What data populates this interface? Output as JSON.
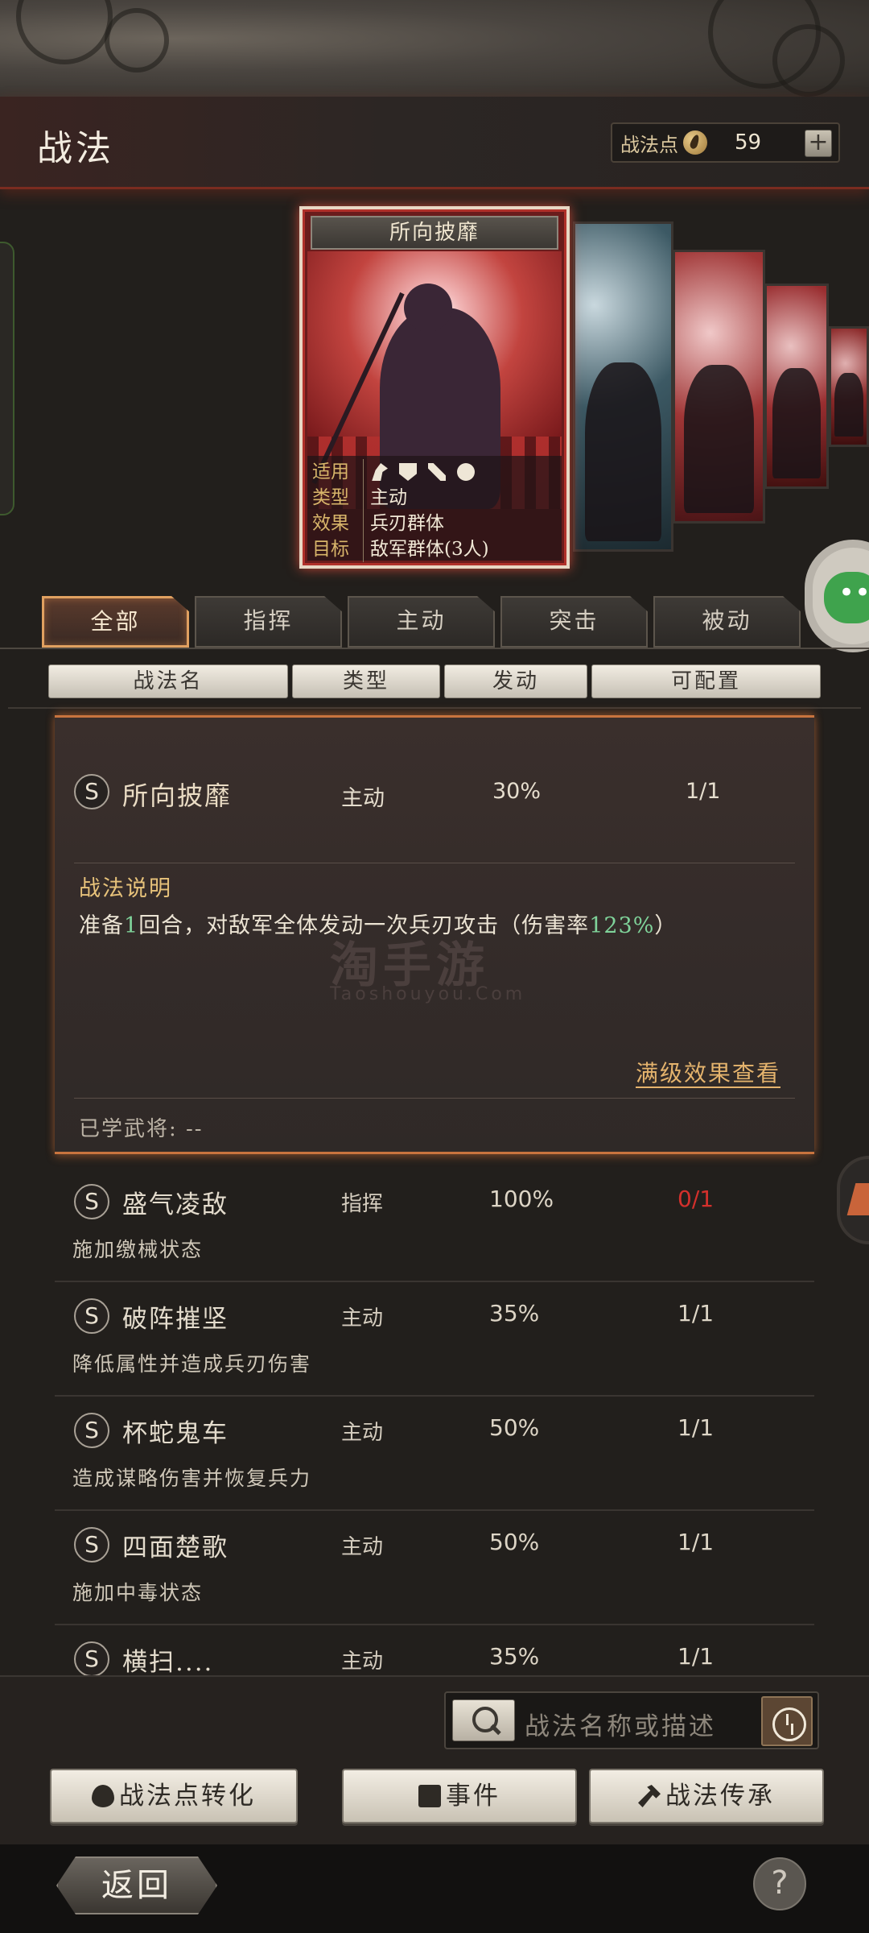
{
  "header": {
    "title": "战法",
    "points_label": "战法点",
    "points_value": "59",
    "add_label": "+"
  },
  "card": {
    "name": "所向披靡",
    "rows": [
      {
        "key": "适用",
        "value": ""
      },
      {
        "key": "类型",
        "value": "主动"
      },
      {
        "key": "效果",
        "value": "兵刃群体"
      },
      {
        "key": "目标",
        "value": "敌军群体(3人)"
      }
    ],
    "apply_icons": [
      "horse-icon",
      "shield-icon",
      "bow-icon",
      "wheel-icon"
    ]
  },
  "tabs": [
    {
      "label": "全部",
      "active": true
    },
    {
      "label": "指挥",
      "active": false
    },
    {
      "label": "主动",
      "active": false
    },
    {
      "label": "突击",
      "active": false
    },
    {
      "label": "被动",
      "active": false
    }
  ],
  "table_headers": [
    "战法名",
    "类型",
    "发动",
    "可配置"
  ],
  "expanded": {
    "grade": "S",
    "name": "所向披靡",
    "type": "主动",
    "rate": "30%",
    "config": "1/1",
    "desc_title": "战法说明",
    "desc_a": "准备",
    "desc_b": "1",
    "desc_c": "回合，对敌军全体发动一次兵刃攻击（伤害率",
    "desc_d": "123%",
    "desc_e": "）",
    "full_effect_link": "满级效果查看",
    "learned": "已学武将: --"
  },
  "watermark": {
    "main": "淘手游",
    "sub": "Taoshouyou.Com"
  },
  "items": [
    {
      "grade": "S",
      "name": "盛气凌敌",
      "type": "指挥",
      "rate": "100%",
      "config": "0/1",
      "config_red": true,
      "desc": "施加缴械状态"
    },
    {
      "grade": "S",
      "name": "破阵摧坚",
      "type": "主动",
      "rate": "35%",
      "config": "1/1",
      "config_red": false,
      "desc": "降低属性并造成兵刃伤害"
    },
    {
      "grade": "S",
      "name": "杯蛇鬼车",
      "type": "主动",
      "rate": "50%",
      "config": "1/1",
      "config_red": false,
      "desc": "造成谋略伤害并恢复兵力"
    },
    {
      "grade": "S",
      "name": "四面楚歌",
      "type": "主动",
      "rate": "50%",
      "config": "1/1",
      "config_red": false,
      "desc": "施加中毒状态"
    },
    {
      "grade": "S",
      "name": "横扫....",
      "type": "主动",
      "rate": "35%",
      "config": "1/1",
      "config_red": false,
      "desc": ""
    }
  ],
  "search": {
    "placeholder": "战法名称或描述"
  },
  "buttons": {
    "convert": "战法点转化",
    "event": "事件",
    "inherit": "战法传承"
  },
  "footer": {
    "back": "返回",
    "help": "?"
  }
}
